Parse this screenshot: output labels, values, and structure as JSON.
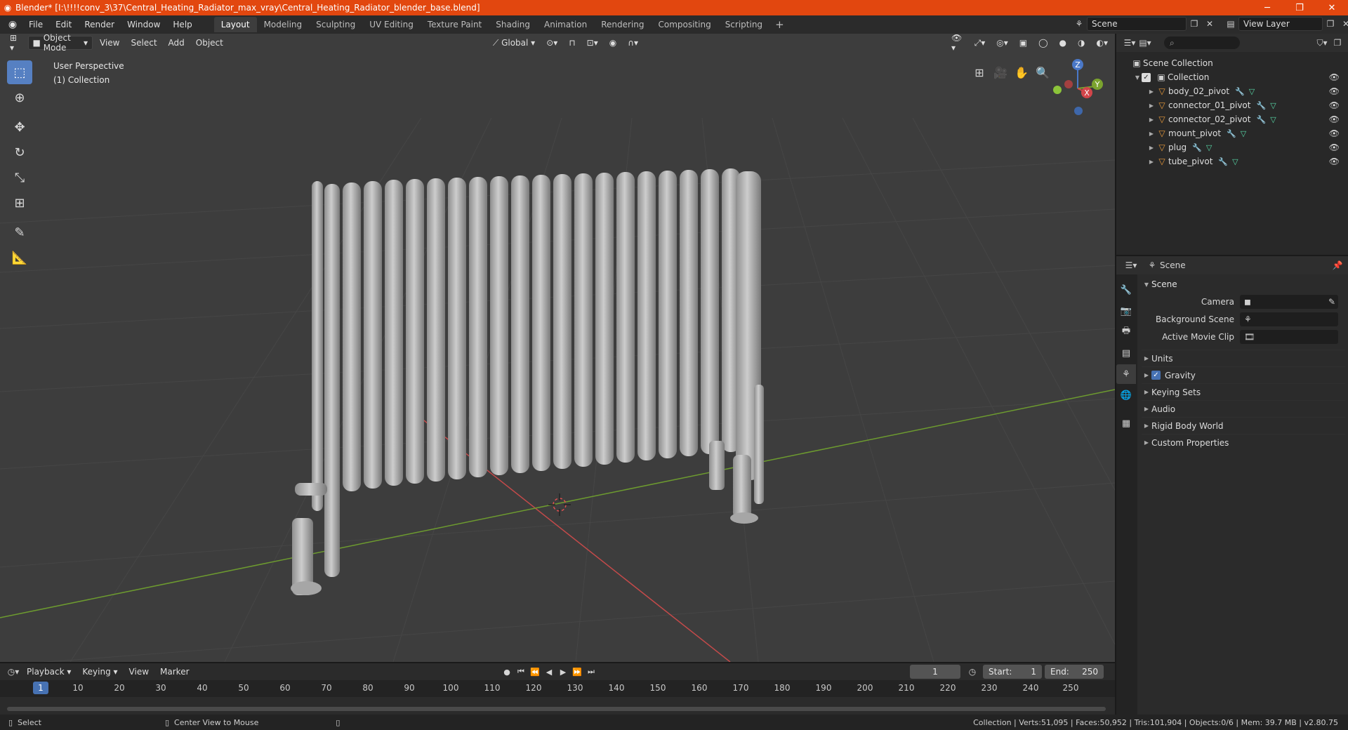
{
  "window": {
    "title": "Blender* [I:\\!!!!conv_3\\37\\Central_Heating_Radiator_max_vray\\Central_Heating_Radiator_blender_base.blend]",
    "minimize": "─",
    "maximize": "❐",
    "close": "✕"
  },
  "menubar": {
    "items": [
      "File",
      "Edit",
      "Render",
      "Window",
      "Help"
    ],
    "workspaces": [
      "Layout",
      "Modeling",
      "Sculpting",
      "UV Editing",
      "Texture Paint",
      "Shading",
      "Animation",
      "Rendering",
      "Compositing",
      "Scripting"
    ],
    "add_label": "+",
    "scene": "Scene",
    "view_layer": "View Layer"
  },
  "viewport": {
    "mode": "Object Mode",
    "menus": [
      "View",
      "Select",
      "Add",
      "Object"
    ],
    "transform": "Global",
    "perspective_label": "User Perspective",
    "collection_label": "(1) Collection",
    "gizmo": {
      "x": "X",
      "y": "Y",
      "z": "Z"
    }
  },
  "outliner": {
    "search_placeholder": "",
    "root": "Scene Collection",
    "collection": "Collection",
    "objects": [
      "body_02_pivot",
      "connector_01_pivot",
      "connector_02_pivot",
      "mount_pivot",
      "plug",
      "tube_pivot"
    ]
  },
  "properties": {
    "header": "Scene",
    "panel": "Scene",
    "fields": [
      {
        "label": "Camera",
        "value": ""
      },
      {
        "label": "Background Scene",
        "value": ""
      },
      {
        "label": "Active Movie Clip",
        "value": ""
      }
    ],
    "subpanels": [
      "Units",
      "Gravity",
      "Keying Sets",
      "Audio",
      "Rigid Body World",
      "Custom Properties"
    ],
    "gravity_checked": true
  },
  "timeline": {
    "menus": [
      "Playback",
      "Keying",
      "View",
      "Marker"
    ],
    "current_frame": "1",
    "start_label": "Start:",
    "start": "1",
    "end_label": "End:",
    "end": "250",
    "ticks": [
      "10",
      "20",
      "30",
      "40",
      "50",
      "60",
      "70",
      "80",
      "90",
      "100",
      "110",
      "120",
      "130",
      "140",
      "150",
      "160",
      "170",
      "180",
      "190",
      "200",
      "210",
      "220",
      "230",
      "240",
      "250"
    ]
  },
  "statusbar": {
    "left": "Select",
    "middle": "Center View to Mouse",
    "stats": "Collection | Verts:51,095 | Faces:50,952 | Tris:101,904 | Objects:0/6 | Mem: 39.7 MB | v2.80.75"
  },
  "colors": {
    "titlebar": "#e2470f",
    "accent": "#4772b3",
    "viewport_bg": "#3d3d3d"
  }
}
